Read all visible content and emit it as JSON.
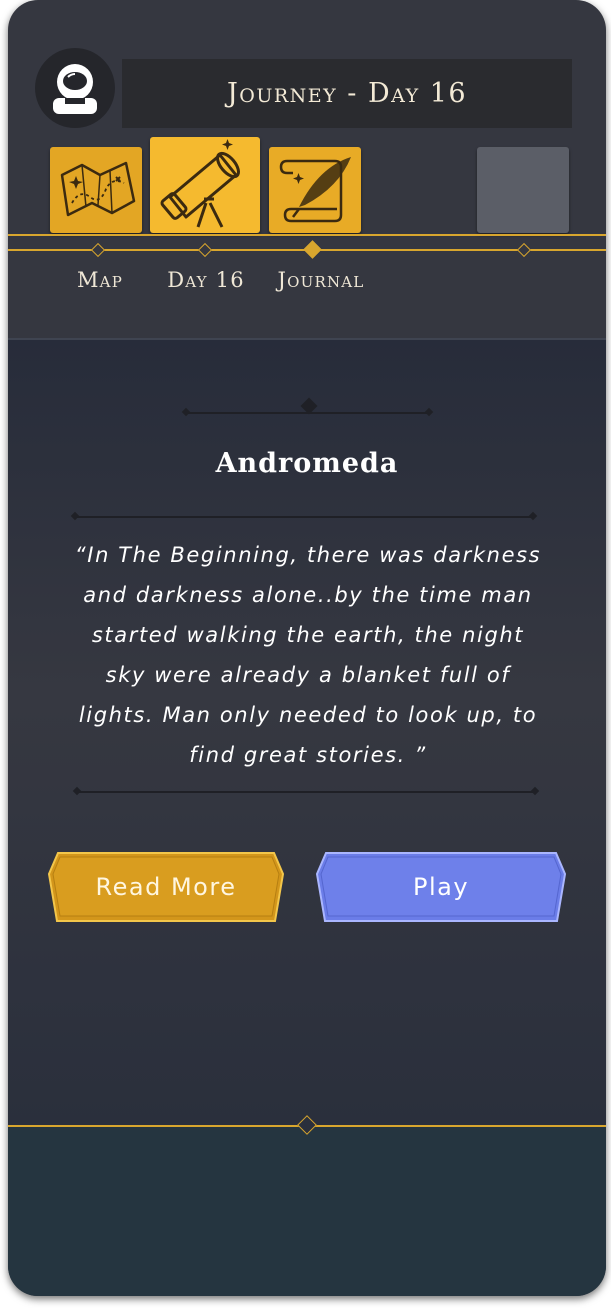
{
  "header": {
    "title": "Journey - Day 16",
    "avatar_icon": "astronaut-icon"
  },
  "tabs": [
    {
      "label": "Map",
      "icon": "treasure-map-icon"
    },
    {
      "label": "Day 16",
      "icon": "telescope-icon",
      "active": true
    },
    {
      "label": "Journal",
      "icon": "quill-scroll-icon"
    }
  ],
  "card": {
    "title": "Andromeda",
    "quote_lines": [
      "“In The Beginning, there was darkness",
      "and darkness alone..by the time man",
      "started walking the earth, the night",
      "sky were already a blanket full of",
      "lights. Man only needed to look up, to",
      "find great stories. ”"
    ]
  },
  "buttons": {
    "read_more": "Read More",
    "play": "Play"
  },
  "colors": {
    "gold": "#d8a62e",
    "tile_gold": "#f2b52e",
    "play_blue": "#6b7de8",
    "panel": "#353740"
  }
}
